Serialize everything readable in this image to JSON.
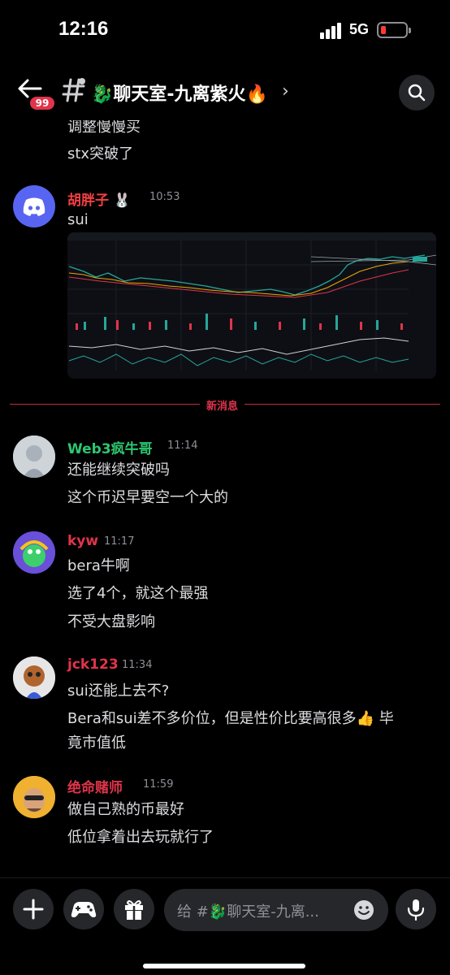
{
  "status_bar": {
    "time": "12:16",
    "network": "5G"
  },
  "header": {
    "unread_badge": "99",
    "channel_name": "🐉聊天室-九离紫火🔥",
    "chevron": "›"
  },
  "messages": {
    "prev_partial": "调整慢慢买",
    "prev_line": "stx突破了",
    "m1": {
      "author": "胡胖子 🐰",
      "time": "10:53",
      "text": "sui",
      "author_color": "#f23f42"
    },
    "new_divider": "新消息",
    "m2": {
      "author": "Web3疯牛哥",
      "time": "11:14",
      "lines": [
        "还能继续突破吗",
        "这个币迟早要空一个大的"
      ],
      "author_color": "#2dc770"
    },
    "m3": {
      "author": "kyw",
      "time": "11:17",
      "lines": [
        "bera牛啊",
        "选了4个，就这个最强",
        "不受大盘影响"
      ],
      "author_color": "#e0344b"
    },
    "m4": {
      "author": "jck123",
      "time": "11:34",
      "lines": [
        "sui还能上去不?",
        "Bera和sui差不多价位，但是性价比要高很多👍 毕",
        "竟市值低"
      ],
      "author_color": "#e0344b"
    },
    "m5": {
      "author": "绝命赌师",
      "time": "11:59",
      "lines": [
        "做自己熟的币最好",
        "低位拿着出去玩就行了"
      ],
      "author_color": "#e0344b"
    }
  },
  "input": {
    "placeholder": "给 #🐉聊天室-九离..."
  },
  "colors": {
    "accent_red": "#e0344b",
    "background": "#000000",
    "surface": "#26272b"
  },
  "icons": [
    "back-arrow-icon",
    "channel-hash-icon",
    "search-icon",
    "discord-logo-icon",
    "plus-icon",
    "gamepad-icon",
    "gift-icon",
    "emoji-icon",
    "microphone-icon"
  ]
}
